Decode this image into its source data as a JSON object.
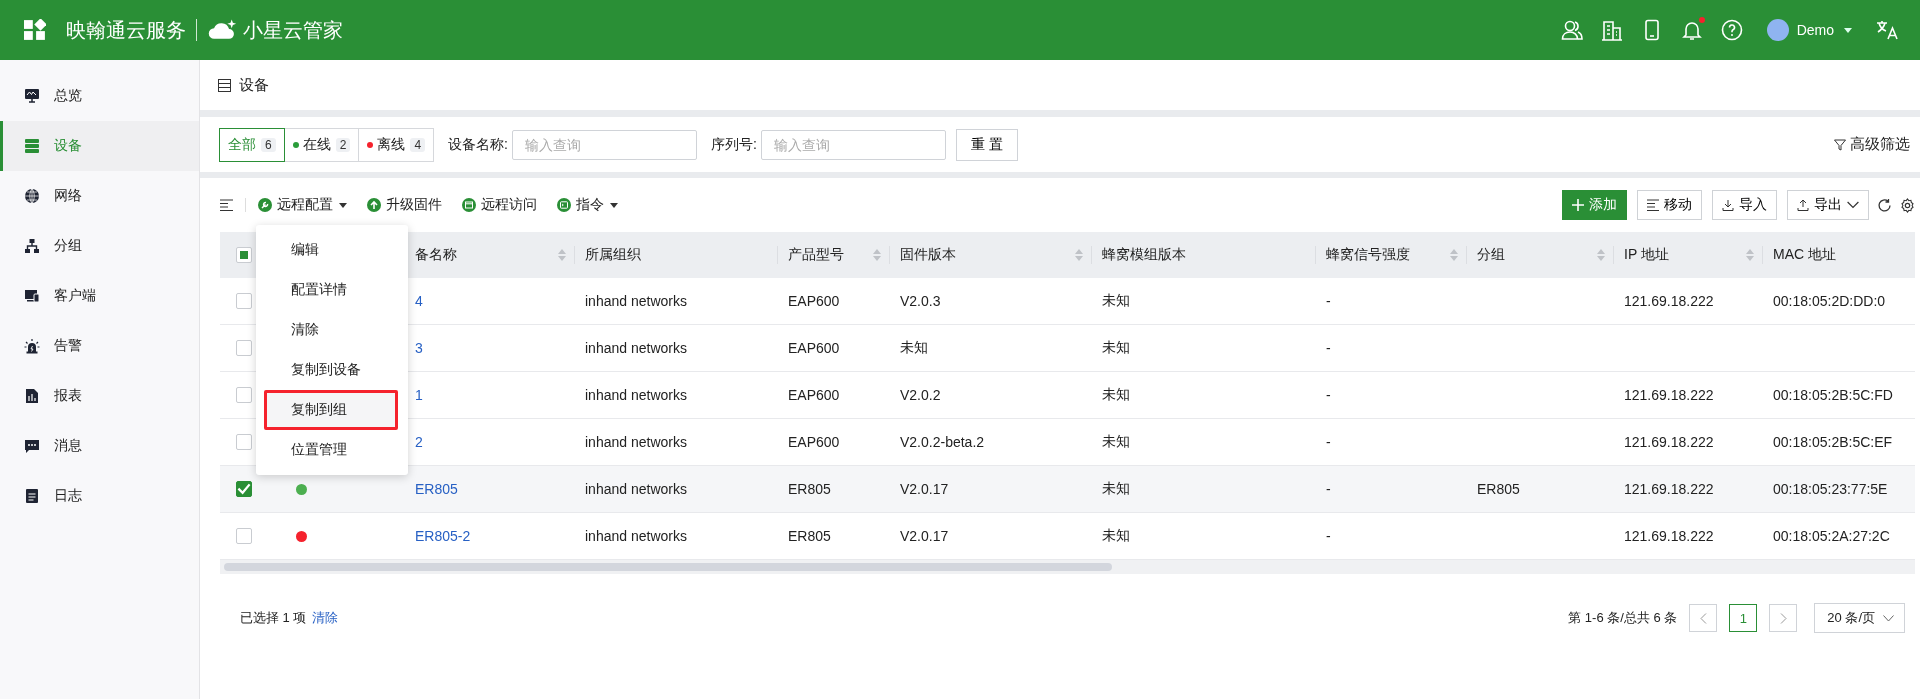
{
  "header": {
    "brand": "映翰通云服务",
    "product": "小星云管家",
    "user": "Demo",
    "notification_dot": true
  },
  "sidebar": {
    "items": [
      {
        "label": "总览",
        "selected": false
      },
      {
        "label": "设备",
        "selected": true
      },
      {
        "label": "网络",
        "selected": false
      },
      {
        "label": "分组",
        "selected": false
      },
      {
        "label": "客户端",
        "selected": false
      },
      {
        "label": "告警",
        "selected": false
      },
      {
        "label": "报表",
        "selected": false
      },
      {
        "label": "消息",
        "selected": false
      },
      {
        "label": "日志",
        "selected": false
      }
    ]
  },
  "page_title": "设备",
  "filter": {
    "tabs": [
      {
        "label": "全部",
        "count": "6",
        "selected": true
      },
      {
        "label": "在线",
        "count": "2",
        "selected": false,
        "color": "#2a9d3a"
      },
      {
        "label": "离线",
        "count": "4",
        "selected": false,
        "color": "#f5222d"
      }
    ],
    "fields": [
      {
        "label": "设备名称:",
        "placeholder": "输入查询"
      },
      {
        "label": "序列号:",
        "placeholder": "输入查询"
      }
    ],
    "reset": "重 置",
    "advanced": "高级筛选"
  },
  "toolbar": {
    "actions": [
      {
        "label": "远程配置",
        "dropdown": true
      },
      {
        "label": "升级固件",
        "dropdown": false
      },
      {
        "label": "远程访问",
        "dropdown": false
      },
      {
        "label": "指令",
        "dropdown": true
      }
    ],
    "buttons": [
      {
        "label": "添加",
        "kind": "primary"
      },
      {
        "label": "移动",
        "kind": "move"
      },
      {
        "label": "导入",
        "kind": "import"
      },
      {
        "label": "导出",
        "kind": "export"
      }
    ]
  },
  "menu": {
    "items": [
      {
        "label": "编辑",
        "highlighted": false
      },
      {
        "label": "配置详情",
        "highlighted": false
      },
      {
        "label": "清除",
        "highlighted": false
      },
      {
        "label": "复制到设备",
        "highlighted": false
      },
      {
        "label": "复制到组",
        "highlighted": true
      },
      {
        "label": "位置管理",
        "highlighted": false
      }
    ]
  },
  "table": {
    "header_checkbox": {
      "indeterminate": true
    },
    "columns": [
      {
        "label": "备名称",
        "sortable": true
      },
      {
        "label": "所属组织",
        "sortable": false
      },
      {
        "label": "产品型号",
        "sortable": true
      },
      {
        "label": "固件版本",
        "sortable": true
      },
      {
        "label": "蜂窝模组版本",
        "sortable": false
      },
      {
        "label": "蜂窝信号强度",
        "sortable": true
      },
      {
        "label": "分组",
        "sortable": true
      },
      {
        "label": "IP 地址",
        "sortable": true
      },
      {
        "label": "MAC 地址",
        "sortable": false
      }
    ],
    "rows": [
      {
        "selected": false,
        "cells": [
          "4",
          "inhand networks",
          "EAP600",
          "V2.0.3",
          "未知",
          "-",
          null,
          "121.69.18.222",
          "00:18:05:2D:DD:0"
        ]
      },
      {
        "selected": false,
        "cells": [
          "3",
          "inhand networks",
          "EAP600",
          "未知",
          "未知",
          "-",
          null,
          null,
          null
        ]
      },
      {
        "selected": false,
        "cells": [
          "1",
          "inhand networks",
          "EAP600",
          "V2.0.2",
          "未知",
          "-",
          null,
          "121.69.18.222",
          "00:18:05:2B:5C:FD"
        ]
      },
      {
        "selected": false,
        "cells": [
          "2",
          "inhand networks",
          "EAP600",
          "V2.0.2-beta.2",
          "未知",
          "-",
          null,
          "121.69.18.222",
          "00:18:05:2B:5C:EF"
        ]
      },
      {
        "selected": true,
        "color": "#4caf50",
        "cells": [
          "ER805",
          "inhand networks",
          "ER805",
          "V2.0.17",
          "未知",
          "-",
          "ER805",
          "121.69.18.222",
          "00:18:05:23:77:5E"
        ]
      },
      {
        "selected": false,
        "color": "#f5222d",
        "cells": [
          "ER805-2",
          "inhand networks",
          "ER805",
          "V2.0.17",
          "未知",
          "-",
          null,
          "121.69.18.222",
          "00:18:05:2A:27:2C"
        ]
      }
    ]
  },
  "footer": {
    "selected_text": "已选择 1 项",
    "clear_link": "清除",
    "range": "第 1-6 条/总共 6 条",
    "pages": [
      {
        "label": "1",
        "selected": true
      }
    ],
    "page_size": "20 条/页"
  }
}
